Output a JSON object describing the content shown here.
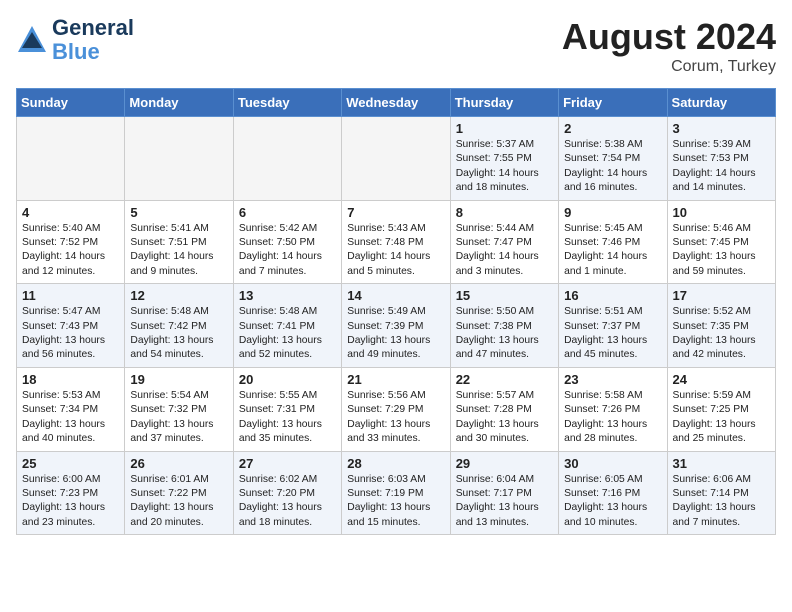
{
  "header": {
    "logo_line1": "General",
    "logo_line2": "Blue",
    "month_year": "August 2024",
    "location": "Corum, Turkey"
  },
  "days_of_week": [
    "Sunday",
    "Monday",
    "Tuesday",
    "Wednesday",
    "Thursday",
    "Friday",
    "Saturday"
  ],
  "weeks": [
    [
      {
        "day": "",
        "content": "",
        "empty": true
      },
      {
        "day": "",
        "content": "",
        "empty": true
      },
      {
        "day": "",
        "content": "",
        "empty": true
      },
      {
        "day": "",
        "content": "",
        "empty": true
      },
      {
        "day": "1",
        "content": "Sunrise: 5:37 AM\nSunset: 7:55 PM\nDaylight: 14 hours\nand 18 minutes."
      },
      {
        "day": "2",
        "content": "Sunrise: 5:38 AM\nSunset: 7:54 PM\nDaylight: 14 hours\nand 16 minutes."
      },
      {
        "day": "3",
        "content": "Sunrise: 5:39 AM\nSunset: 7:53 PM\nDaylight: 14 hours\nand 14 minutes."
      }
    ],
    [
      {
        "day": "4",
        "content": "Sunrise: 5:40 AM\nSunset: 7:52 PM\nDaylight: 14 hours\nand 12 minutes."
      },
      {
        "day": "5",
        "content": "Sunrise: 5:41 AM\nSunset: 7:51 PM\nDaylight: 14 hours\nand 9 minutes."
      },
      {
        "day": "6",
        "content": "Sunrise: 5:42 AM\nSunset: 7:50 PM\nDaylight: 14 hours\nand 7 minutes."
      },
      {
        "day": "7",
        "content": "Sunrise: 5:43 AM\nSunset: 7:48 PM\nDaylight: 14 hours\nand 5 minutes."
      },
      {
        "day": "8",
        "content": "Sunrise: 5:44 AM\nSunset: 7:47 PM\nDaylight: 14 hours\nand 3 minutes."
      },
      {
        "day": "9",
        "content": "Sunrise: 5:45 AM\nSunset: 7:46 PM\nDaylight: 14 hours\nand 1 minute."
      },
      {
        "day": "10",
        "content": "Sunrise: 5:46 AM\nSunset: 7:45 PM\nDaylight: 13 hours\nand 59 minutes."
      }
    ],
    [
      {
        "day": "11",
        "content": "Sunrise: 5:47 AM\nSunset: 7:43 PM\nDaylight: 13 hours\nand 56 minutes."
      },
      {
        "day": "12",
        "content": "Sunrise: 5:48 AM\nSunset: 7:42 PM\nDaylight: 13 hours\nand 54 minutes."
      },
      {
        "day": "13",
        "content": "Sunrise: 5:48 AM\nSunset: 7:41 PM\nDaylight: 13 hours\nand 52 minutes."
      },
      {
        "day": "14",
        "content": "Sunrise: 5:49 AM\nSunset: 7:39 PM\nDaylight: 13 hours\nand 49 minutes."
      },
      {
        "day": "15",
        "content": "Sunrise: 5:50 AM\nSunset: 7:38 PM\nDaylight: 13 hours\nand 47 minutes."
      },
      {
        "day": "16",
        "content": "Sunrise: 5:51 AM\nSunset: 7:37 PM\nDaylight: 13 hours\nand 45 minutes."
      },
      {
        "day": "17",
        "content": "Sunrise: 5:52 AM\nSunset: 7:35 PM\nDaylight: 13 hours\nand 42 minutes."
      }
    ],
    [
      {
        "day": "18",
        "content": "Sunrise: 5:53 AM\nSunset: 7:34 PM\nDaylight: 13 hours\nand 40 minutes."
      },
      {
        "day": "19",
        "content": "Sunrise: 5:54 AM\nSunset: 7:32 PM\nDaylight: 13 hours\nand 37 minutes."
      },
      {
        "day": "20",
        "content": "Sunrise: 5:55 AM\nSunset: 7:31 PM\nDaylight: 13 hours\nand 35 minutes."
      },
      {
        "day": "21",
        "content": "Sunrise: 5:56 AM\nSunset: 7:29 PM\nDaylight: 13 hours\nand 33 minutes."
      },
      {
        "day": "22",
        "content": "Sunrise: 5:57 AM\nSunset: 7:28 PM\nDaylight: 13 hours\nand 30 minutes."
      },
      {
        "day": "23",
        "content": "Sunrise: 5:58 AM\nSunset: 7:26 PM\nDaylight: 13 hours\nand 28 minutes."
      },
      {
        "day": "24",
        "content": "Sunrise: 5:59 AM\nSunset: 7:25 PM\nDaylight: 13 hours\nand 25 minutes."
      }
    ],
    [
      {
        "day": "25",
        "content": "Sunrise: 6:00 AM\nSunset: 7:23 PM\nDaylight: 13 hours\nand 23 minutes."
      },
      {
        "day": "26",
        "content": "Sunrise: 6:01 AM\nSunset: 7:22 PM\nDaylight: 13 hours\nand 20 minutes."
      },
      {
        "day": "27",
        "content": "Sunrise: 6:02 AM\nSunset: 7:20 PM\nDaylight: 13 hours\nand 18 minutes."
      },
      {
        "day": "28",
        "content": "Sunrise: 6:03 AM\nSunset: 7:19 PM\nDaylight: 13 hours\nand 15 minutes."
      },
      {
        "day": "29",
        "content": "Sunrise: 6:04 AM\nSunset: 7:17 PM\nDaylight: 13 hours\nand 13 minutes."
      },
      {
        "day": "30",
        "content": "Sunrise: 6:05 AM\nSunset: 7:16 PM\nDaylight: 13 hours\nand 10 minutes."
      },
      {
        "day": "31",
        "content": "Sunrise: 6:06 AM\nSunset: 7:14 PM\nDaylight: 13 hours\nand 7 minutes."
      }
    ]
  ]
}
